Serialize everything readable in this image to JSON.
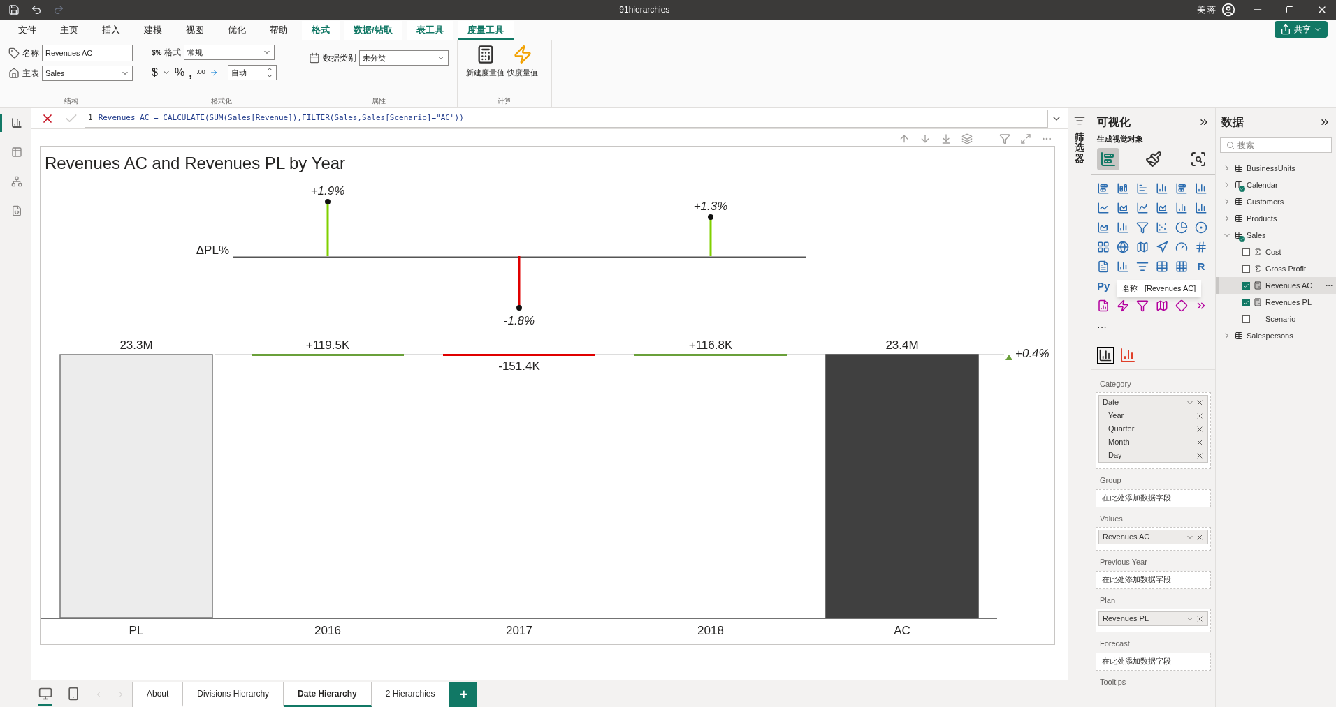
{
  "titlebar": {
    "title": "91hierarchies",
    "user": "美 蒋"
  },
  "ribbon_tabs": [
    {
      "label": "文件",
      "selected": false,
      "kind": "main"
    },
    {
      "label": "主页",
      "selected": false,
      "kind": "main"
    },
    {
      "label": "插入",
      "selected": false,
      "kind": "main"
    },
    {
      "label": "建模",
      "selected": false,
      "kind": "main"
    },
    {
      "label": "视图",
      "selected": false,
      "kind": "main"
    },
    {
      "label": "优化",
      "selected": false,
      "kind": "main"
    },
    {
      "label": "帮助",
      "selected": false,
      "kind": "main"
    },
    {
      "label": "格式",
      "selected": false,
      "kind": "context"
    },
    {
      "label": "数据/钻取",
      "selected": false,
      "kind": "context"
    },
    {
      "label": "表工具",
      "selected": false,
      "kind": "context"
    },
    {
      "label": "度量工具",
      "selected": true,
      "kind": "context"
    }
  ],
  "share_button": "共享",
  "ribbon": {
    "structure": {
      "name_label": "名称",
      "name_value": "Revenues AC",
      "table_label": "主表",
      "table_value": "Sales",
      "group_label": "结构"
    },
    "formatting": {
      "format_icon": "$%",
      "format_label": "格式",
      "format_value": "常规",
      "currency": "$",
      "percent": "%",
      "comma": ",",
      "decimal": ".00",
      "auto_value": "自动",
      "group_label": "格式化"
    },
    "properties": {
      "category_label": "数据类别",
      "category_value": "未分类",
      "group_label": "属性"
    },
    "calculations": {
      "new_measure": "新建度量值",
      "quick_measure": "快度量值",
      "group_label": "计算"
    }
  },
  "nav": [
    {
      "kind": "report",
      "selected": true
    },
    {
      "kind": "table",
      "selected": false
    },
    {
      "kind": "model",
      "selected": false
    },
    {
      "kind": "dax",
      "selected": false
    }
  ],
  "formula": {
    "line": "1",
    "text": "Revenues AC = CALCULATE(SUM(Sales[Revenue]),FILTER(Sales,Sales[Scenario]=\"AC\"))"
  },
  "visual": {
    "title": "Revenues AC and Revenues PL by Year",
    "delta_axis_label": "ΔPL%",
    "columns": [
      {
        "category": "PL",
        "label": "23.3M",
        "kind": "plan_total"
      },
      {
        "category": "2016",
        "label": "+119.5K",
        "kind": "increase",
        "delta": {
          "label": "+1.9%",
          "kind": "up_large"
        }
      },
      {
        "category": "2017",
        "label": "-151.4K",
        "kind": "decrease",
        "delta": {
          "label": "-1.8%",
          "kind": "down_large"
        }
      },
      {
        "category": "2018",
        "label": "+116.8K",
        "kind": "increase",
        "delta": {
          "label": "+1.3%",
          "kind": "up_small"
        }
      },
      {
        "category": "AC",
        "label": "23.4M",
        "kind": "actual_total"
      }
    ],
    "total_change": "+0.4%"
  },
  "filters": {
    "label": "筛选器"
  },
  "visualizations": {
    "title": "可视化",
    "subtitle": "生成视觉对象",
    "tabs": [
      {
        "kind": "build",
        "selected": true
      },
      {
        "kind": "format",
        "selected": false
      },
      {
        "kind": "analytics",
        "selected": false
      }
    ],
    "text_icons": [
      "R",
      "Py"
    ],
    "more": "···",
    "tooltip": {
      "label": "名称",
      "value": "[Revenues AC]"
    },
    "wells": [
      {
        "label": "Category",
        "fields": [
          {
            "name": "Date",
            "kind": "field"
          },
          {
            "name": "Year",
            "kind": "level"
          },
          {
            "name": "Quarter",
            "kind": "level"
          },
          {
            "name": "Month",
            "kind": "level"
          },
          {
            "name": "Day",
            "kind": "level"
          }
        ]
      },
      {
        "label": "Group",
        "placeholder": "在此处添加数据字段"
      },
      {
        "label": "Values",
        "fields": [
          {
            "name": "Revenues AC",
            "kind": "field"
          }
        ]
      },
      {
        "label": "Previous Year",
        "placeholder": "在此处添加数据字段"
      },
      {
        "label": "Plan",
        "fields": [
          {
            "name": "Revenues PL",
            "kind": "field"
          }
        ]
      },
      {
        "label": "Forecast",
        "placeholder": "在此处添加数据字段"
      },
      {
        "label": "Tooltips"
      }
    ]
  },
  "data": {
    "title": "数据",
    "search": {
      "placeholder": "搜索"
    },
    "tables": [
      {
        "name": "BusinessUnits",
        "expanded": false,
        "badge": false
      },
      {
        "name": "Calendar",
        "expanded": false,
        "badge": true
      },
      {
        "name": "Customers",
        "expanded": false,
        "badge": false
      },
      {
        "name": "Products",
        "expanded": false,
        "badge": false
      },
      {
        "name": "Sales",
        "expanded": true,
        "badge": true,
        "children": [
          {
            "name": "Cost",
            "kind": "sum",
            "checked": false,
            "selected": false
          },
          {
            "name": "Gross Profit",
            "kind": "sum",
            "checked": false,
            "selected": false
          },
          {
            "name": "Revenues AC",
            "kind": "measure",
            "checked": true,
            "selected": true
          },
          {
            "name": "Revenues PL",
            "kind": "measure",
            "checked": true,
            "selected": false
          },
          {
            "name": "Scenario",
            "kind": "column",
            "checked": false,
            "selected": false
          }
        ]
      },
      {
        "name": "Salespersons",
        "expanded": false,
        "badge": false
      }
    ]
  },
  "layout_views": [
    {
      "kind": "desktop",
      "selected": true
    },
    {
      "kind": "mobile",
      "selected": false
    }
  ],
  "pages": [
    {
      "label": "About",
      "selected": false
    },
    {
      "label": "Divisions Hierarchy",
      "selected": false
    },
    {
      "label": "Date Hierarchy",
      "selected": true
    },
    {
      "label": "2 Hierarchies",
      "selected": false
    }
  ],
  "add_page": "+"
}
